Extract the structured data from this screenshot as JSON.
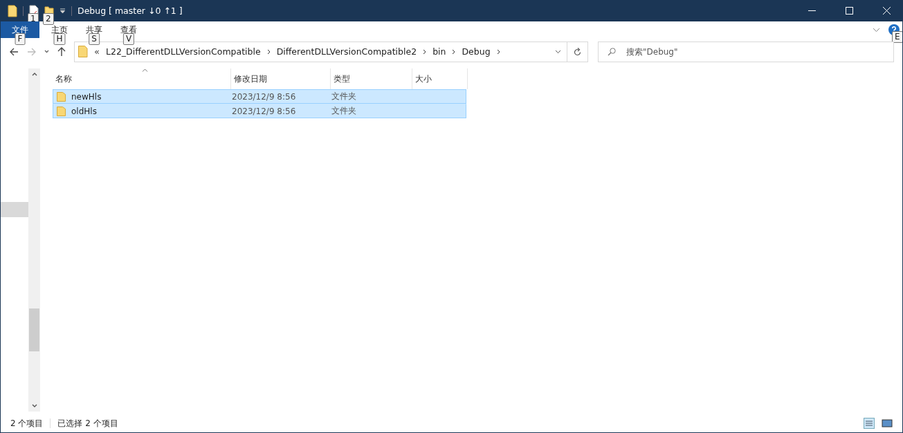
{
  "window": {
    "title": "Debug [ master ↓0 ↑1 ]",
    "quick_access_keytips": [
      "1",
      "2"
    ]
  },
  "ribbon": {
    "tabs": [
      {
        "label": "文件",
        "keytip": "F",
        "kind": "file",
        "selected": false
      },
      {
        "label": "主页",
        "keytip": "H",
        "kind": "tab",
        "selected": false
      },
      {
        "label": "共享",
        "keytip": "S",
        "kind": "tab",
        "selected": false
      },
      {
        "label": "查看",
        "keytip": "V",
        "kind": "tab",
        "selected": false
      }
    ],
    "help_keytip": "E"
  },
  "address_bar": {
    "overflow": "«",
    "segments": [
      "L22_DifferentDLLVersionCompatible",
      "DifferentDLLVersionCompatible2",
      "bin",
      "Debug"
    ]
  },
  "search": {
    "placeholder": "搜索\"Debug\""
  },
  "table": {
    "columns": [
      {
        "label": "名称",
        "sorted": true
      },
      {
        "label": "修改日期",
        "sorted": false
      },
      {
        "label": "类型",
        "sorted": false
      },
      {
        "label": "大小",
        "sorted": false
      }
    ],
    "rows": [
      {
        "name": "newHls",
        "modified": "2023/12/9 8:56",
        "type": "文件夹",
        "selected": true
      },
      {
        "name": "oldHls",
        "modified": "2023/12/9 8:56",
        "type": "文件夹",
        "selected": true
      }
    ]
  },
  "status_bar": {
    "item_count": "2 个项目",
    "selection": "已选择 2 个项目"
  }
}
